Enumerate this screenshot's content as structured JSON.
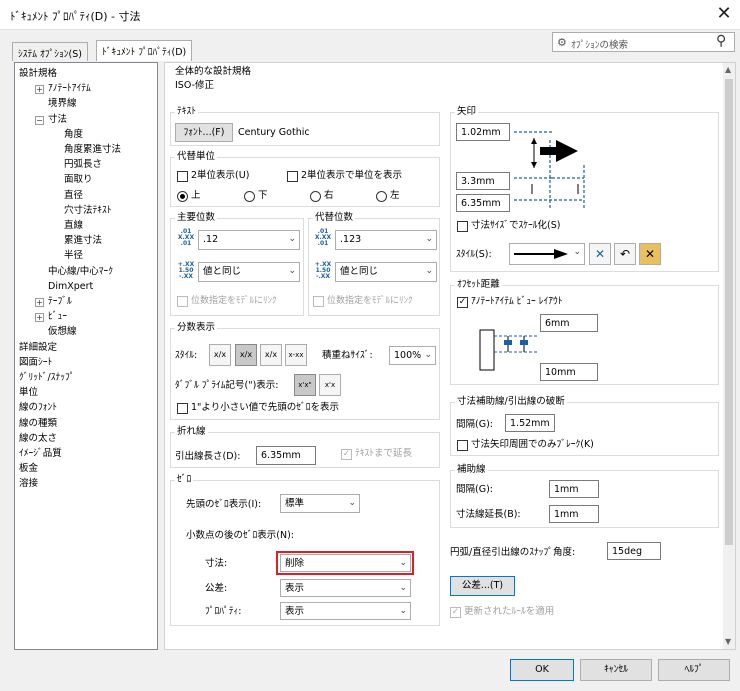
{
  "window": {
    "title": "ﾄﾞｷｭﾒﾝﾄ ﾌﾟﾛﾊﾟﾃｨ(D) - 寸法",
    "close": "✕"
  },
  "tabs": [
    "ｼｽﾃﾑ ｵﾌﾟｼｮﾝ(S)",
    "ﾄﾞｷｭﾒﾝﾄ ﾌﾟﾛﾊﾟﾃｨ(D)"
  ],
  "search": {
    "placeholder": "ｵﾌﾟｼｮﾝの検索"
  },
  "tree": [
    "設計規格",
    "ｱﾉﾃｰﾄｱｲﾃﾑ",
    "境界線",
    "寸法",
    "角度",
    "角度累進寸法",
    "円弧長さ",
    "面取り",
    "直径",
    "穴寸法ﾃｷｽﾄ",
    "直線",
    "累進寸法",
    "半径",
    "中心線/中心ﾏｰｸ",
    "DimXpert",
    "ﾃｰﾌﾞﾙ",
    "ﾋﾞｭｰ",
    "仮想線",
    "詳細設定",
    "図面ｼｰﾄ",
    "ｸﾞﾘｯﾄﾞ/ｽﾅｯﾌﾟ",
    "単位",
    "線のﾌｫﾝﾄ",
    "線の種類",
    "線の太さ",
    "ｲﾒｰｼﾞ品質",
    "板金",
    "溶接"
  ],
  "overall": {
    "title": "全体的な設計規格",
    "value": "ISO-修正"
  },
  "text": {
    "title": "ﾃｷｽﾄ",
    "font_button": "ﾌｫﾝﾄ...(F)",
    "font_name": "Century Gothic"
  },
  "dual": {
    "title": "代替単位",
    "show": "2単位表示(U)",
    "show_units": "2単位表示で単位を表示",
    "pos": [
      "上",
      "下",
      "右",
      "左"
    ]
  },
  "primary": {
    "title": "主要位数",
    "prec": ".12",
    "tol": "値と同じ",
    "link": "位数指定をﾓﾃﾞﾙにﾘﾝｸ",
    "icon1": ".01 X.XX .01",
    "icon2": "+.XX 1.50 -.XX"
  },
  "alt": {
    "title": "代替位数",
    "prec": ".123",
    "tol": "値と同じ",
    "link": "位数指定をﾓﾃﾞﾙにﾘﾝｸ"
  },
  "fraction": {
    "title": "分数表示",
    "style": "ｽﾀｲﾙ:",
    "stack": "積重ねｻｲｽﾞ:",
    "stack_val": "100%",
    "dprime": "ﾀﾞﾌﾞﾙ ﾌﾟﾗｲﾑ記号(\")表示:",
    "zero": "1\"より小さい値で先頭のｾﾞﾛを表示",
    "icons": [
      "x/x",
      "x/x",
      "x/x",
      "x-xx"
    ],
    "dp_icons": [
      "x'x\"",
      "x'x"
    ]
  },
  "bent": {
    "title": "折れ線",
    "len_label": "引出線長さ(D):",
    "len": "6.35mm",
    "extend": "ﾃｷｽﾄまで延長"
  },
  "zero": {
    "title": "ｾﾞﾛ",
    "lead_label": "先頭のｾﾞﾛ表示(I):",
    "lead": "標準",
    "trail_label": "小数点の後のｾﾞﾛ表示(N):",
    "dim_label": "寸法:",
    "dim": "削除",
    "tol_label": "公差:",
    "tol": "表示",
    "prop_label": "ﾌﾟﾛﾊﾟﾃｨ:",
    "prop": "表示"
  },
  "arrows": {
    "title": "矢印",
    "v1": "1.02mm",
    "v2": "3.3mm",
    "v3": "6.35mm",
    "scale": "寸法ｻｲｽﾞでｽｹｰﾙ化(S)",
    "style_label": "ｽﾀｲﾙ(S):"
  },
  "offset": {
    "title": "ｵﾌｾｯﾄ距離",
    "annot": "ｱﾉﾃｰﾄｱｲﾃﾑ ﾋﾞｭｰ ﾚｲｱｳﾄ",
    "v1": "6mm",
    "v2": "10mm"
  },
  "ext_break": {
    "title": "寸法補助線/引出線の破断",
    "gap_label": "間隔(G):",
    "gap": "1.52mm",
    "arrow_only": "寸法矢印周囲でのみﾌﾞﾚｰｸ(K)"
  },
  "ext_lines": {
    "title": "補助線",
    "gap_label": "間隔(G):",
    "gap": "1mm",
    "ext_label": "寸法線延長(B):",
    "ext": "1mm"
  },
  "arc": {
    "label": "円弧/直径引出線のｽﾅｯﾌﾟ角度:",
    "value": "15deg"
  },
  "tol_button": "公差...(T)",
  "apply_rules": "更新されたﾙｰﾙを適用",
  "footer": {
    "ok": "OK",
    "cancel": "ｷｬﾝｾﾙ",
    "help": "ﾍﾙﾌﾟ"
  },
  "colors": {
    "highlight": "#e01e26",
    "accent": "#0078d7"
  }
}
